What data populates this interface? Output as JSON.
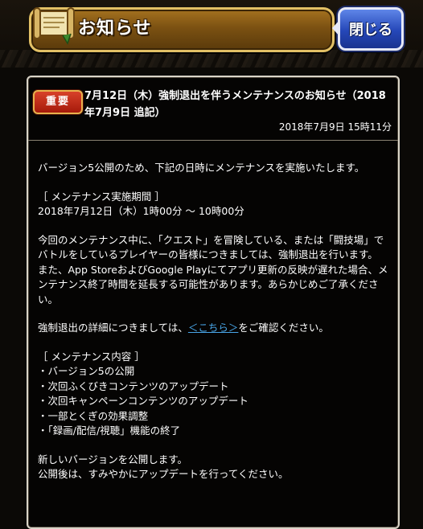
{
  "header": {
    "title": "お知らせ",
    "close_label": "閉じる"
  },
  "notice": {
    "badge": "重要",
    "title": "7月12日（木）強制退出を伴うメンテナンスのお知らせ（2018年7月9日 追記）",
    "date": "2018年7月9日 15時11分",
    "intro": "バージョン5公開のため、下記の日時にメンテナンスを実施いたします。",
    "period_heading": "［ メンテナンス実施期間 ］",
    "period_value": "2018年7月12日（木）1時00分 ～ 10時00分",
    "warning_1": "今回のメンテナンス中に、「クエスト」を冒険している、または「闘技場」でバトルをしているプレイヤーの皆様につきましては、強制退出を行います。",
    "warning_2": "また、App StoreおよびGoogle Playにてアプリ更新の反映が遅れた場合、メンテナンス終了時間を延長する可能性があります。あらかじめご了承ください。",
    "detail_prefix": "強制退出の詳細につきましては、",
    "detail_link": "＜こちら＞",
    "detail_suffix": "をご確認ください。",
    "contents_heading": "［ メンテナンス内容 ］",
    "contents": [
      "・バージョン5の公開",
      "・次回ふくびきコンテンツのアップデート",
      "・次回キャンペーンコンテンツのアップデート",
      "・一部とくぎの効果調整",
      "・「録画/配信/視聴」機能の終了"
    ],
    "closing_1": "新しいバージョンを公開します。",
    "closing_2": "公開後は、すみやかにアップデートを行ってください。"
  },
  "colors": {
    "link": "#49a6e8",
    "badge": "#c52c17",
    "close_button": "#2f55c8",
    "title_plate": "#7b5112"
  },
  "icons": [
    "scroll-icon"
  ]
}
